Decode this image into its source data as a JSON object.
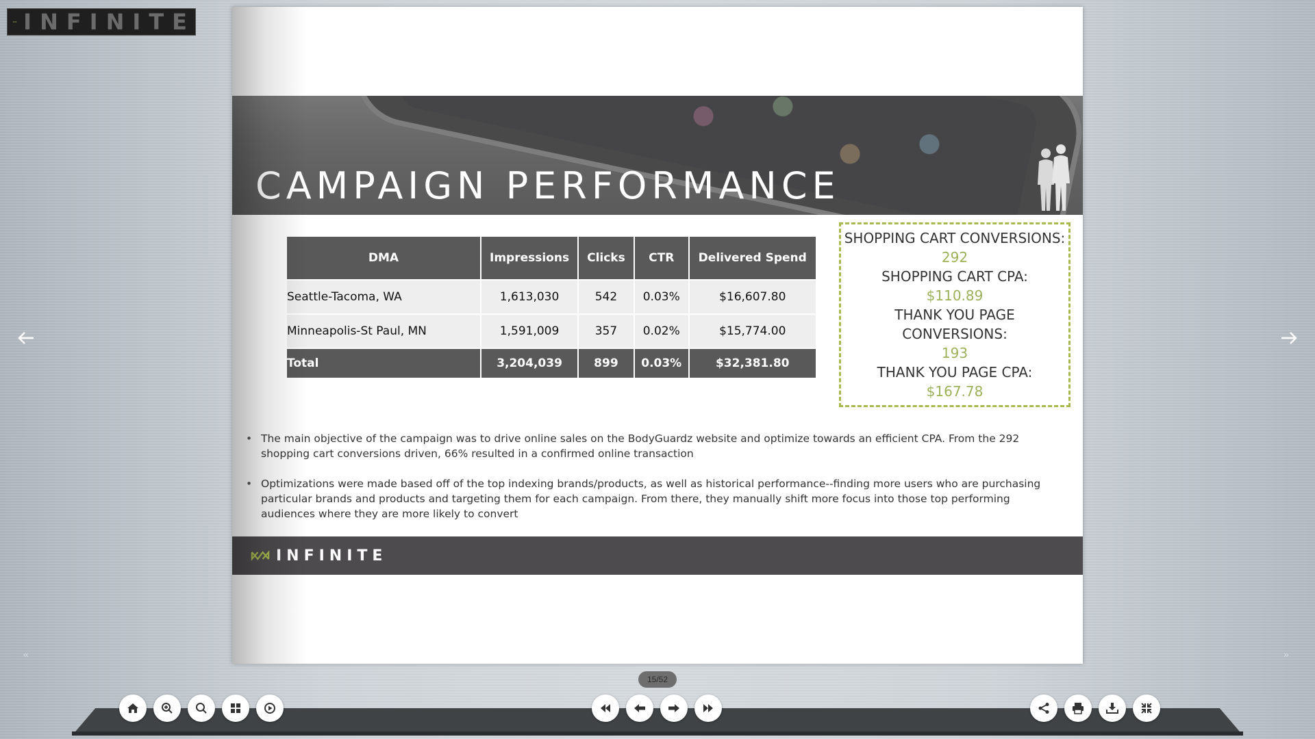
{
  "brand": {
    "name": "INFINITE",
    "accent": "#a6b94f"
  },
  "slide": {
    "title": "CAMPAIGN PERFORMANCE",
    "table": {
      "headers": [
        "DMA",
        "Impressions",
        "Clicks",
        "CTR",
        "Delivered Spend"
      ],
      "rows": [
        [
          "Seattle-Tacoma, WA",
          "1,613,030",
          "542",
          "0.03%",
          "$16,607.80"
        ],
        [
          "Minneapolis-St Paul, MN",
          "1,591,009",
          "357",
          "0.02%",
          "$15,774.00"
        ]
      ],
      "total": [
        "Total",
        "3,204,039",
        "899",
        "0.03%",
        "$32,381.80"
      ]
    },
    "conversions": [
      {
        "label": "SHOPPING CART CONVERSIONS:",
        "value": "292"
      },
      {
        "label": "SHOPPING CART CPA:",
        "value": "$110.89"
      },
      {
        "label": "THANK YOU PAGE CONVERSIONS:",
        "value": "193"
      },
      {
        "label": "THANK YOU PAGE CPA:",
        "value": "$167.78"
      }
    ],
    "bullets": [
      "The main objective of the campaign was to drive online sales on the BodyGuardz website and optimize towards an efficient CPA. From the 292 shopping cart conversions driven, 66% resulted in a confirmed online transaction",
      "Optimizations were made based off of the top indexing brands/products, as well as historical performance--finding more users who are purchasing particular brands and products and targeting them for each campaign. From there, they manually shift more focus into those top performing audiences where they are more likely to convert"
    ]
  },
  "viewer": {
    "page_counter": "15/52",
    "left_tools": [
      "home-icon",
      "zoom-in-icon",
      "search-icon",
      "thumbnails-icon",
      "autoplay-icon"
    ],
    "nav_tools": [
      "first-page-icon",
      "previous-page-icon",
      "next-page-icon",
      "last-page-icon"
    ],
    "right_tools": [
      "share-icon",
      "print-icon",
      "download-icon",
      "fullscreen-icon"
    ]
  }
}
